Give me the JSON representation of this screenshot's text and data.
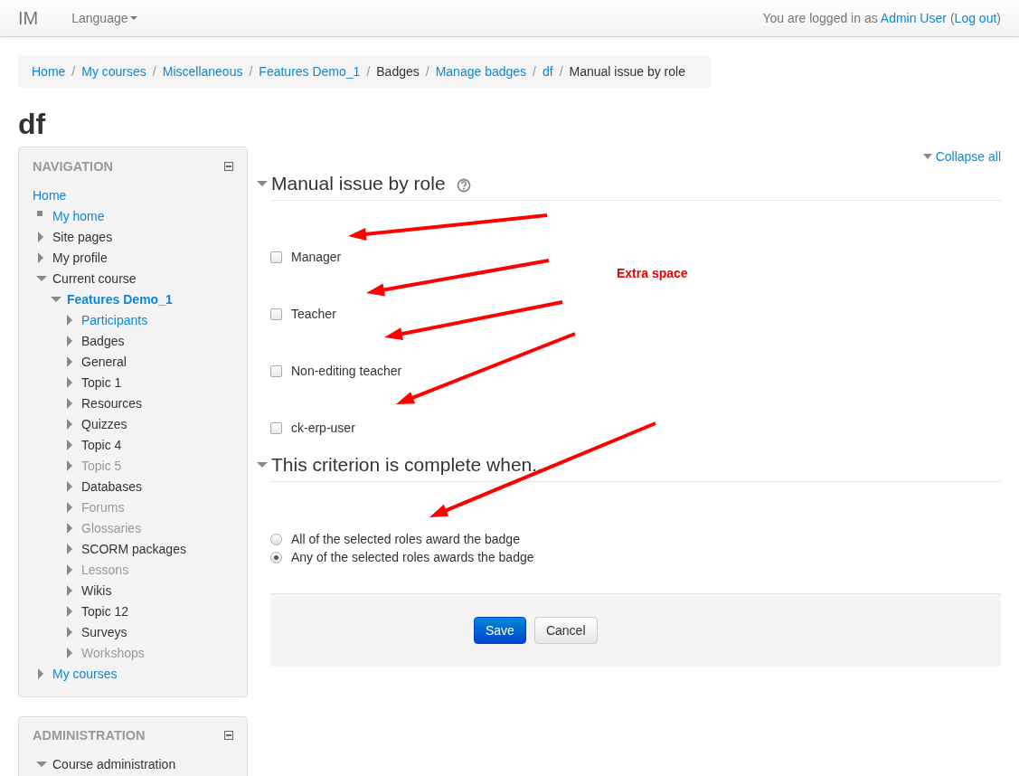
{
  "navbar": {
    "brand": "IM",
    "language_menu": "Language",
    "login_prefix": "You are logged in as",
    "user_name": "Admin User",
    "logout_open": "(",
    "logout": "Log out",
    "logout_close": ")"
  },
  "breadcrumb": [
    {
      "label": "Home",
      "link": true
    },
    {
      "separator": "/",
      "label": "My courses",
      "link": true
    },
    {
      "separator": "/",
      "label": "Miscellaneous",
      "link": true
    },
    {
      "separator": "/",
      "label": "Features Demo_1",
      "link": true
    },
    {
      "separator": "/",
      "label": "Badges",
      "link": false
    },
    {
      "separator": "/",
      "label": "Manage badges",
      "link": true
    },
    {
      "separator": "/",
      "label": "df",
      "link": true
    },
    {
      "separator": "/",
      "label": "Manual issue by role",
      "link": false
    }
  ],
  "page_title": "df",
  "navigation": {
    "title": "NAVIGATION",
    "items": [
      {
        "label": "Home",
        "kind": "root",
        "link": true,
        "dimmed": false,
        "current": false
      },
      {
        "label": "My home",
        "kind": "bullet",
        "link": true,
        "dimmed": false,
        "current": false
      },
      {
        "label": "Site pages",
        "kind": "branch",
        "link": false,
        "dimmed": false,
        "current": false,
        "expanded": false
      },
      {
        "label": "My profile",
        "kind": "branch",
        "link": false,
        "dimmed": false,
        "current": false,
        "expanded": false
      },
      {
        "label": "Current course",
        "kind": "branch",
        "link": false,
        "dimmed": false,
        "current": false,
        "expanded": true,
        "children": [
          {
            "label": "Features Demo_1",
            "kind": "branch",
            "link": true,
            "dimmed": false,
            "current": true,
            "expanded": true,
            "children": [
              {
                "label": "Participants",
                "kind": "branch",
                "link": true,
                "dimmed": false,
                "current": false,
                "expanded": false
              },
              {
                "label": "Badges",
                "kind": "branch",
                "link": false,
                "dimmed": false,
                "current": false,
                "expanded": false
              },
              {
                "label": "General",
                "kind": "branch",
                "link": false,
                "dimmed": false,
                "current": false,
                "expanded": false
              },
              {
                "label": "Topic 1",
                "kind": "branch",
                "link": false,
                "dimmed": false,
                "current": false,
                "expanded": false
              },
              {
                "label": "Resources",
                "kind": "branch",
                "link": false,
                "dimmed": false,
                "current": false,
                "expanded": false
              },
              {
                "label": "Quizzes",
                "kind": "branch",
                "link": false,
                "dimmed": false,
                "current": false,
                "expanded": false
              },
              {
                "label": "Topic 4",
                "kind": "branch",
                "link": false,
                "dimmed": false,
                "current": false,
                "expanded": false
              },
              {
                "label": "Topic 5",
                "kind": "branch",
                "link": false,
                "dimmed": true,
                "current": false,
                "expanded": false
              },
              {
                "label": "Databases",
                "kind": "branch",
                "link": false,
                "dimmed": false,
                "current": false,
                "expanded": false
              },
              {
                "label": "Forums",
                "kind": "branch",
                "link": false,
                "dimmed": true,
                "current": false,
                "expanded": false
              },
              {
                "label": "Glossaries",
                "kind": "branch",
                "link": false,
                "dimmed": true,
                "current": false,
                "expanded": false
              },
              {
                "label": "SCORM packages",
                "kind": "branch",
                "link": false,
                "dimmed": false,
                "current": false,
                "expanded": false
              },
              {
                "label": "Lessons",
                "kind": "branch",
                "link": false,
                "dimmed": true,
                "current": false,
                "expanded": false
              },
              {
                "label": "Wikis",
                "kind": "branch",
                "link": false,
                "dimmed": false,
                "current": false,
                "expanded": false
              },
              {
                "label": "Topic 12",
                "kind": "branch",
                "link": false,
                "dimmed": false,
                "current": false,
                "expanded": false
              },
              {
                "label": "Surveys",
                "kind": "branch",
                "link": false,
                "dimmed": false,
                "current": false,
                "expanded": false
              },
              {
                "label": "Workshops",
                "kind": "branch",
                "link": false,
                "dimmed": true,
                "current": false,
                "expanded": false
              }
            ]
          }
        ]
      },
      {
        "label": "My courses",
        "kind": "branch",
        "link": true,
        "dimmed": false,
        "current": false,
        "expanded": false
      }
    ]
  },
  "administration": {
    "title": "ADMINISTRATION",
    "items": [
      {
        "label": "Course administration",
        "kind": "branch",
        "link": false,
        "dimmed": false,
        "current": false,
        "expanded": true
      }
    ]
  },
  "collapse_all": "Collapse all",
  "section_roles": {
    "title": "Manual issue by role",
    "roles": [
      {
        "label": "Manager",
        "checked": false
      },
      {
        "label": "Teacher",
        "checked": false
      },
      {
        "label": "Non-editing teacher",
        "checked": false
      },
      {
        "label": "ck-erp-user",
        "checked": false
      }
    ]
  },
  "section_complete": {
    "title": "This criterion is complete when...",
    "options": [
      {
        "label": "All of the selected roles award the badge",
        "selected": false
      },
      {
        "label": "Any of the selected roles awards the badge",
        "selected": true
      }
    ]
  },
  "annotation": "Extra space",
  "buttons": [
    {
      "label": "Save",
      "kind": "primary"
    },
    {
      "label": "Cancel",
      "kind": "default"
    }
  ]
}
